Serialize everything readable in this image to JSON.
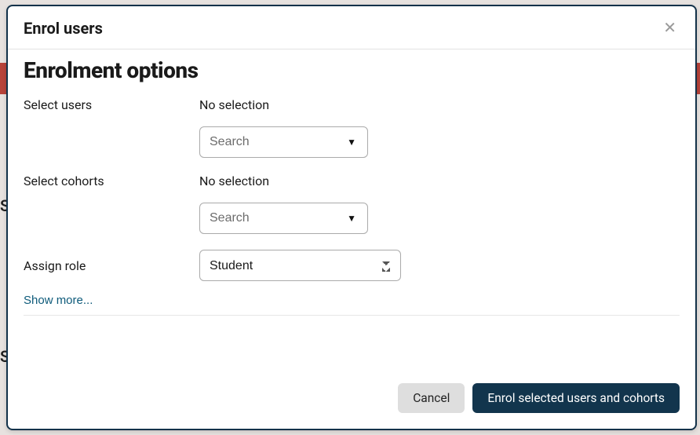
{
  "modal": {
    "title": "Enrol users",
    "section_title": "Enrolment options",
    "users": {
      "label": "Select users",
      "no_selection": "No selection",
      "placeholder": "Search"
    },
    "cohorts": {
      "label": "Select cohorts",
      "no_selection": "No selection",
      "placeholder": "Search"
    },
    "role": {
      "label": "Assign role",
      "value": "Student"
    },
    "show_more": "Show more...",
    "cancel": "Cancel",
    "submit": "Enrol selected users and cohorts"
  }
}
